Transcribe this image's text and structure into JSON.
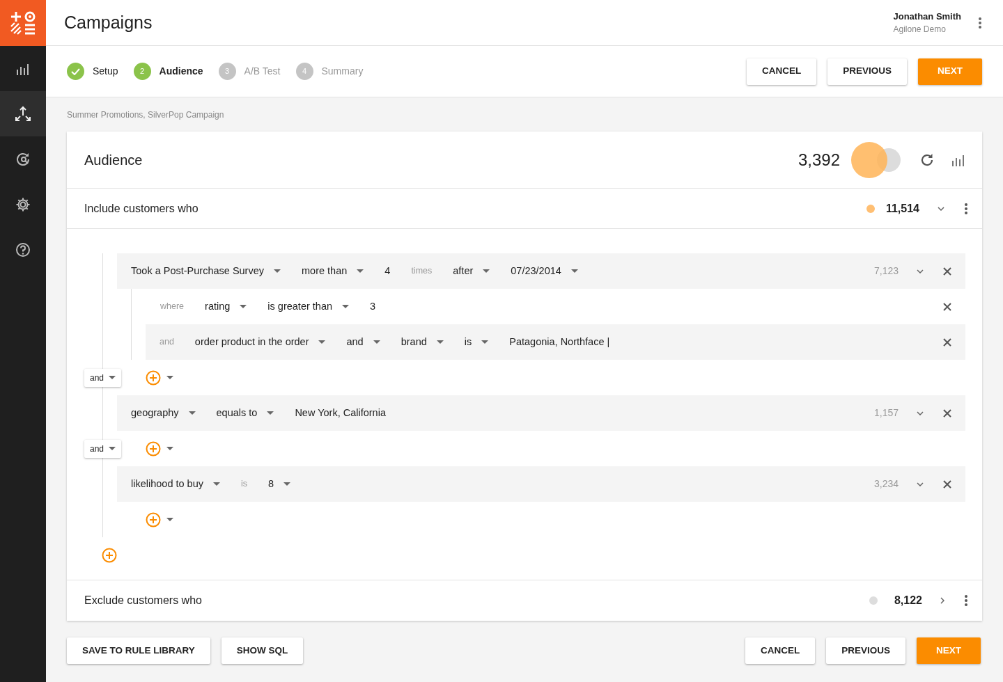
{
  "sidebar": {
    "items": [
      {
        "selected": false
      },
      {
        "selected": true
      },
      {
        "selected": false
      },
      {
        "selected": false
      },
      {
        "selected": false
      }
    ]
  },
  "header": {
    "title": "Campaigns",
    "user_name": "Jonathan Smith",
    "organization": "Agilone Demo"
  },
  "steps": [
    {
      "label": "Setup",
      "completed": true,
      "selected": false
    },
    {
      "number": "2",
      "label": "Audience",
      "completed": false,
      "selected": true
    },
    {
      "number": "3",
      "label": "A/B Test",
      "completed": false,
      "selected": false
    },
    {
      "number": "4",
      "label": "Summary",
      "completed": false,
      "selected": false
    }
  ],
  "top_buttons": [
    {
      "label": "CANCEL",
      "kind": "default"
    },
    {
      "label": "PREVIOUS",
      "kind": "default"
    },
    {
      "label": "NEXT",
      "kind": "primary"
    }
  ],
  "breadcrumb": "Summer Promotions, SilverPop Campaign",
  "audience": {
    "title": "Audience",
    "count": "3,392"
  },
  "include": {
    "title": "Include customers who",
    "count": "11,514",
    "color": "#ffbf73",
    "expanded": true
  },
  "rules": [
    {
      "tokens": [
        {
          "kind": "dropdown",
          "text": "Took a Post-Purchase Survey"
        },
        {
          "kind": "dropdown",
          "text": "more than"
        },
        {
          "kind": "value",
          "text": "4"
        },
        {
          "kind": "label",
          "text": "times"
        },
        {
          "kind": "dropdown",
          "text": "after"
        },
        {
          "kind": "dropdown",
          "text": "07/23/2014"
        }
      ],
      "count": "7,123",
      "connector": "and",
      "conditions": [
        {
          "shaded": false,
          "tokens": [
            {
              "kind": "label",
              "text": "where"
            },
            {
              "kind": "dropdown",
              "text": "rating"
            },
            {
              "kind": "dropdown",
              "text": "is greater than"
            },
            {
              "kind": "value",
              "text": "3"
            }
          ]
        },
        {
          "shaded": true,
          "tokens": [
            {
              "kind": "label",
              "text": "and"
            },
            {
              "kind": "dropdown",
              "text": "order product in the order"
            },
            {
              "kind": "dropdown",
              "text": "and"
            },
            {
              "kind": "dropdown",
              "text": "brand"
            },
            {
              "kind": "dropdown",
              "text": "is"
            },
            {
              "kind": "value",
              "text": "Patagonia, Northface |"
            }
          ]
        }
      ]
    },
    {
      "tokens": [
        {
          "kind": "dropdown",
          "text": "geography"
        },
        {
          "kind": "dropdown",
          "text": "equals to"
        },
        {
          "kind": "value",
          "text": "New York, California"
        }
      ],
      "count": "1,157",
      "connector": "and"
    },
    {
      "tokens": [
        {
          "kind": "dropdown",
          "text": "likelihood to buy"
        },
        {
          "kind": "label",
          "text": "is"
        },
        {
          "kind": "dropdown",
          "text": "8"
        }
      ],
      "count": "3,234"
    }
  ],
  "exclude": {
    "title": "Exclude customers who",
    "count": "8,122",
    "color": "#dddddd",
    "expanded": false
  },
  "bottom_left_buttons": [
    {
      "label": "SAVE TO RULE LIBRARY",
      "kind": "default"
    },
    {
      "label": "SHOW SQL",
      "kind": "default"
    }
  ],
  "bottom_right_buttons": [
    {
      "label": "CANCEL",
      "kind": "default"
    },
    {
      "label": "PREVIOUS",
      "kind": "default"
    },
    {
      "label": "NEXT",
      "kind": "primary"
    }
  ]
}
